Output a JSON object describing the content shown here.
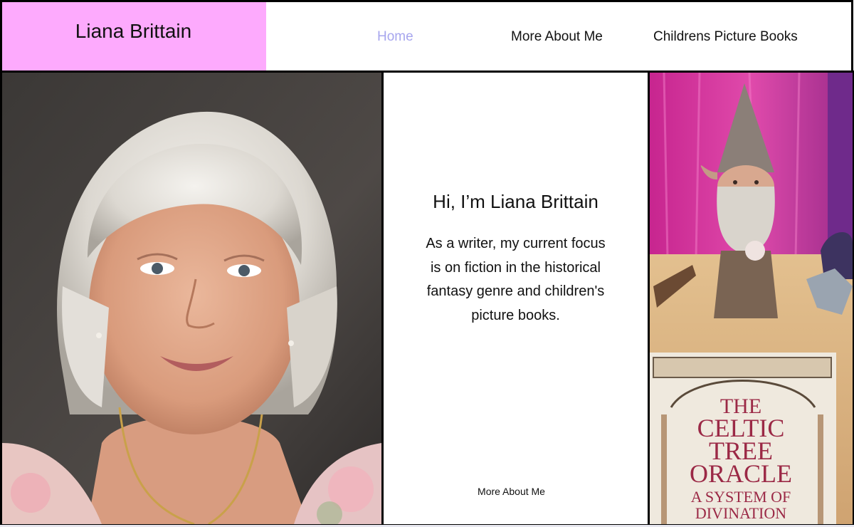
{
  "header": {
    "site_title": "Liana Brittain",
    "nav": [
      {
        "label": "Home",
        "active": true
      },
      {
        "label": "More About Me",
        "active": false
      },
      {
        "label": "Childrens Picture Books",
        "active": false
      }
    ]
  },
  "main": {
    "heading": "Hi, I’m Liana Brittain",
    "intro": "As a writer, my current focus is on fiction in the historical fantasy genre and children's picture books.",
    "more_link": "More About Me"
  },
  "book": {
    "title_line1": "THE",
    "title_line2": "CELTIC",
    "title_line3": "TREE",
    "title_line4": "ORACLE",
    "subtitle_line1": "A SYSTEM OF",
    "subtitle_line2": "DIVINATION"
  },
  "colors": {
    "logo_bg": "#fdaafd",
    "nav_active": "#a7a6ee",
    "border": "#000000"
  }
}
